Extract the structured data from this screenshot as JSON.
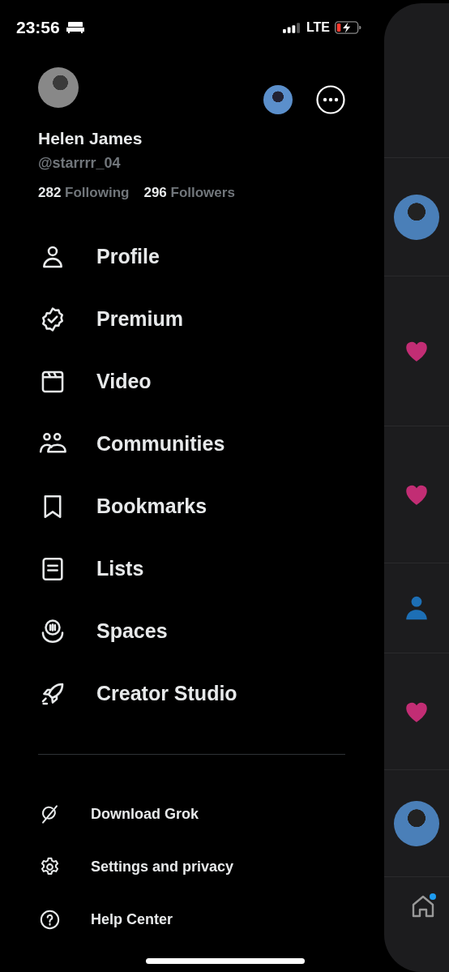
{
  "status_bar": {
    "time": "23:56",
    "network": "LTE"
  },
  "account": {
    "name": "Helen James",
    "handle": "@starrrr_04",
    "following_count": "282",
    "following_label": "Following",
    "followers_count": "296",
    "followers_label": "Followers"
  },
  "menu_items": [
    {
      "label": "Profile"
    },
    {
      "label": "Premium"
    },
    {
      "label": "Video"
    },
    {
      "label": "Communities"
    },
    {
      "label": "Bookmarks"
    },
    {
      "label": "Lists"
    },
    {
      "label": "Spaces"
    },
    {
      "label": "Creator Studio"
    }
  ],
  "secondary_items": [
    {
      "label": "Download Grok"
    },
    {
      "label": "Settings and privacy"
    },
    {
      "label": "Help Center"
    }
  ],
  "timeline_peek": [
    {
      "kind": "blank"
    },
    {
      "kind": "avatar"
    },
    {
      "kind": "like"
    },
    {
      "kind": "like"
    },
    {
      "kind": "follow"
    },
    {
      "kind": "like"
    },
    {
      "kind": "avatar"
    }
  ],
  "home_tab": {
    "badge": true
  }
}
